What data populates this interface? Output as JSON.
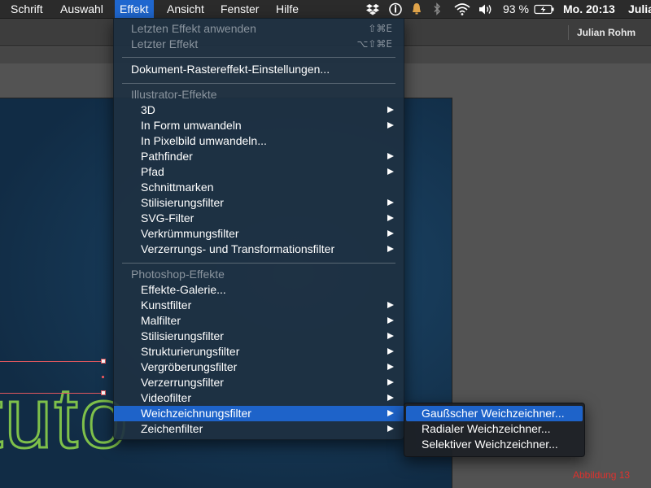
{
  "menubar": {
    "items": [
      {
        "label": "Schrift"
      },
      {
        "label": "Auswahl"
      },
      {
        "label": "Effekt"
      },
      {
        "label": "Ansicht"
      },
      {
        "label": "Fenster"
      },
      {
        "label": "Hilfe"
      }
    ],
    "status": {
      "battery": "93 %",
      "clock": "Mo. 20:13",
      "user": "Julia"
    }
  },
  "app": {
    "user_name": "Julian Rohm"
  },
  "menu": {
    "top": [
      {
        "label": "Letzten Effekt anwenden",
        "shortcut": "⇧⌘E"
      },
      {
        "label": "Letzter Effekt",
        "shortcut": "⌥⇧⌘E"
      },
      {
        "label": "Dokument-Rastereffekt-Einstellungen..."
      }
    ],
    "illustrator_header": "Illustrator-Effekte",
    "illustrator": [
      {
        "label": "3D"
      },
      {
        "label": "In Form umwandeln"
      },
      {
        "label": "In Pixelbild umwandeln..."
      },
      {
        "label": "Pathfinder"
      },
      {
        "label": "Pfad"
      },
      {
        "label": "Schnittmarken"
      },
      {
        "label": "Stilisierungsfilter"
      },
      {
        "label": "SVG-Filter"
      },
      {
        "label": "Verkrümmungsfilter"
      },
      {
        "label": "Verzerrungs- und Transformationsfilter"
      }
    ],
    "photoshop_header": "Photoshop-Effekte",
    "photoshop": [
      {
        "label": "Effekte-Galerie..."
      },
      {
        "label": "Kunstfilter"
      },
      {
        "label": "Malfilter"
      },
      {
        "label": "Stilisierungsfilter"
      },
      {
        "label": "Strukturierungsfilter"
      },
      {
        "label": "Vergröberungsfilter"
      },
      {
        "label": "Verzerrungsfilter"
      },
      {
        "label": "Videofilter"
      },
      {
        "label": "Weichzeichnungsfilter"
      },
      {
        "label": "Zeichenfilter"
      }
    ]
  },
  "submenu": {
    "items": [
      {
        "label": "Gaußscher Weichzeichner..."
      },
      {
        "label": "Radialer Weichzeichner..."
      },
      {
        "label": "Selektiver Weichzeichner..."
      }
    ]
  },
  "artboard": {
    "text": "tuto"
  },
  "caption": "Abbildung 13",
  "colors": {
    "menu_highlight": "#1e63c9",
    "artwork_text": "#7ec04a",
    "selection": "#e0575e",
    "caption": "#e0322e"
  }
}
